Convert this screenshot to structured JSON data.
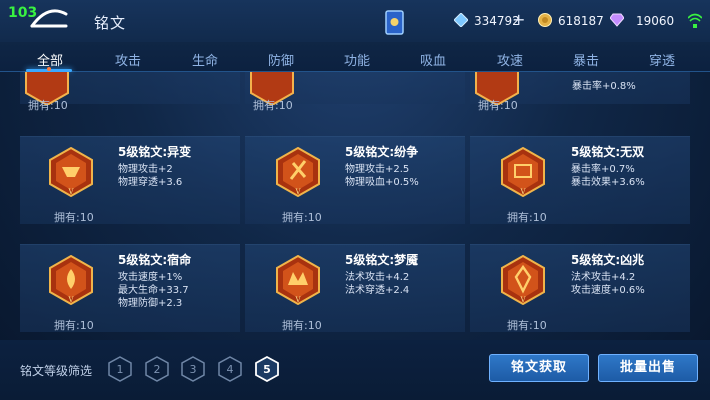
{
  "fps_counter": "103",
  "header": {
    "title": "铭文",
    "back_icon": "back-arrow-icon",
    "resources": [
      {
        "name": "diamond",
        "icon": "diamond-icon",
        "value": "334792",
        "color": "#7ec8ff"
      },
      {
        "name": "gold",
        "icon": "gold-coin-icon",
        "value": "618187",
        "color": "#e6b347"
      },
      {
        "name": "crystal",
        "icon": "crystal-icon",
        "value": "19060",
        "color": "#c48cff"
      }
    ],
    "plus_label": "+"
  },
  "tabs": [
    {
      "label": "全部",
      "active": true
    },
    {
      "label": "攻击",
      "active": false
    },
    {
      "label": "生命",
      "active": false
    },
    {
      "label": "防御",
      "active": false
    },
    {
      "label": "功能",
      "active": false
    },
    {
      "label": "吸血",
      "active": false
    },
    {
      "label": "攻速",
      "active": false
    },
    {
      "label": "暴击",
      "active": false
    },
    {
      "label": "穿透",
      "active": false
    }
  ],
  "runes_top_partial": [
    {
      "owned": "拥有:10"
    },
    {
      "owned": "拥有:10"
    },
    {
      "owned": "拥有:10",
      "partial_stat": "暴击率+0.8%"
    }
  ],
  "runes": [
    {
      "name": "5级铭文:异变",
      "stats": [
        "物理攻击+2",
        "物理穿透+3.6"
      ],
      "owned": "拥有:10"
    },
    {
      "name": "5级铭文:纷争",
      "stats": [
        "物理攻击+2.5",
        "物理吸血+0.5%"
      ],
      "owned": "拥有:10"
    },
    {
      "name": "5级铭文:无双",
      "stats": [
        "暴击率+0.7%",
        "暴击效果+3.6%"
      ],
      "owned": "拥有:10"
    },
    {
      "name": "5级铭文:宿命",
      "stats": [
        "攻击速度+1%",
        "最大生命+33.7",
        "物理防御+2.3"
      ],
      "owned": "拥有:10"
    },
    {
      "name": "5级铭文:梦魇",
      "stats": [
        "法术攻击+4.2",
        "法术穿透+2.4"
      ],
      "owned": "拥有:10"
    },
    {
      "name": "5级铭文:凶兆",
      "stats": [
        "法术攻击+4.2",
        "攻击速度+0.6%"
      ],
      "owned": "拥有:10"
    }
  ],
  "footer": {
    "filter_label": "铭文等级筛选",
    "levels": [
      "1",
      "2",
      "3",
      "4",
      "5"
    ],
    "selected_level": "5",
    "obtain_button": "铭文获取",
    "bulk_sell_button": "批量出售"
  }
}
